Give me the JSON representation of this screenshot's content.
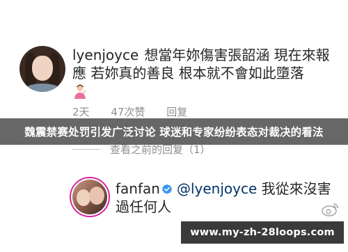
{
  "banner": {
    "title": "魏震禁赛处罚引发广泛讨论 球迷和专家纷纷表态对裁决的看法"
  },
  "comment1": {
    "username": "lyenjoyce",
    "text": "想當年妳傷害張韶涵 現在來報應 若妳真的善良 根本就不會如此墮落",
    "emoji": "person-gesturing-icon",
    "time": "2天",
    "likes": "47次赞",
    "reply": "回复"
  },
  "view_previous": {
    "label": "查看之前的回复（1）"
  },
  "comment2": {
    "username": "fanfan",
    "mention": "@lyenjoyce",
    "text": "我從來沒害過任何人"
  },
  "footer": {
    "url": "www.my-zh-28loops.com"
  },
  "colors": {
    "banner_bg": "#3c3c3c",
    "mention": "#003569",
    "verified": "#3897f0",
    "story_ring": "#d6249f"
  }
}
